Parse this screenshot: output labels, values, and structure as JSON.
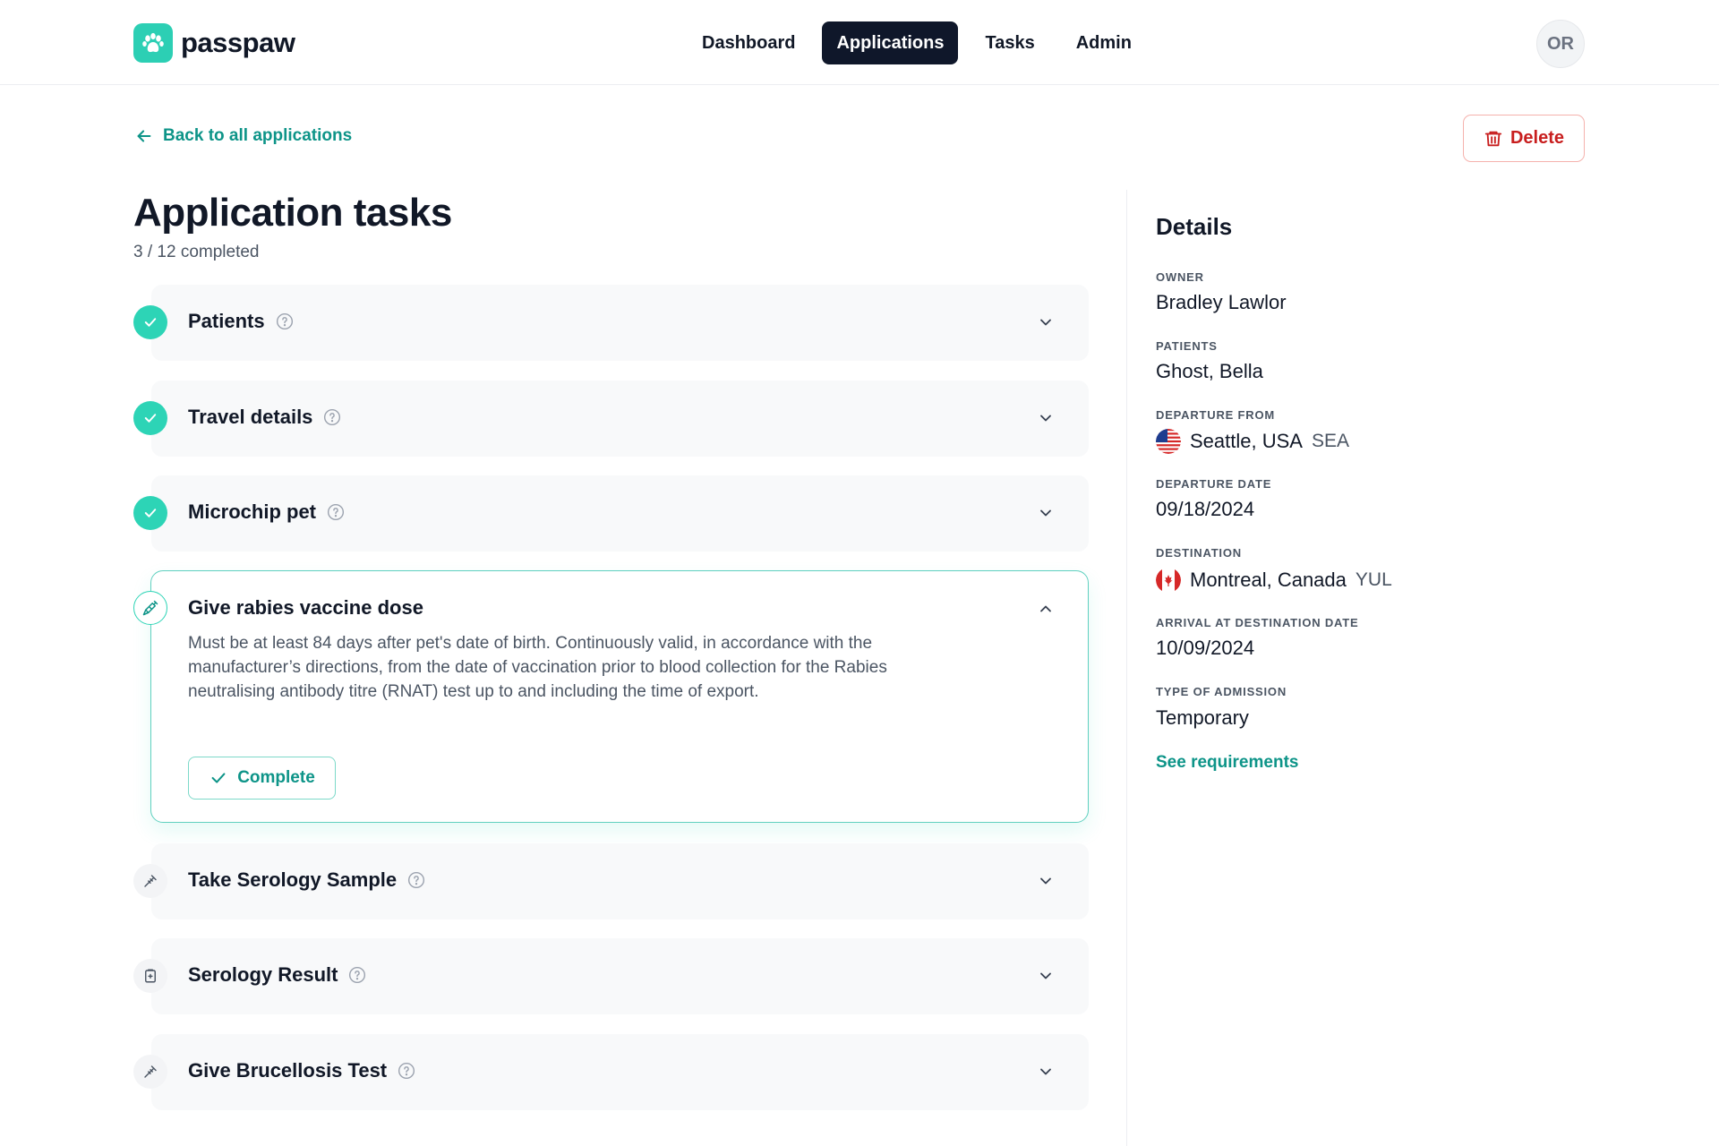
{
  "brand": {
    "name": "passpaw",
    "accent": "#2dd4b6",
    "link_color": "#0d9488",
    "danger": "#c81e1e",
    "nav_active_bg": "#0f172a"
  },
  "nav": {
    "items": [
      {
        "label": "Dashboard",
        "active": false
      },
      {
        "label": "Applications",
        "active": true
      },
      {
        "label": "Tasks",
        "active": false
      },
      {
        "label": "Admin",
        "active": false
      }
    ]
  },
  "user": {
    "initials": "OR"
  },
  "back_link": {
    "label": "Back to all applications",
    "icon": "arrow-left-icon"
  },
  "delete_button": {
    "label": "Delete",
    "icon": "trash-icon"
  },
  "page": {
    "title": "Application tasks",
    "progress": "3 / 12 completed"
  },
  "tasks": [
    {
      "title": "Patients",
      "status": "completed",
      "icon": "check-icon"
    },
    {
      "title": "Travel details",
      "status": "completed",
      "icon": "check-icon"
    },
    {
      "title": "Microchip pet",
      "status": "completed",
      "icon": "check-icon"
    },
    {
      "title": "Give rabies vaccine dose",
      "status": "in-progress",
      "expanded": true,
      "icon": "syringe-icon",
      "description": "Must be at least 84 days after pet's date of birth. Continuously valid, in accordance with the manufacturer’s directions, from the date of vaccination prior to blood collection for the Rabies neutralising antibody titre (RNAT) test up to and including the time of export.",
      "complete_label": "Complete"
    },
    {
      "title": "Take Serology Sample",
      "status": "pending",
      "icon": "pipette-icon"
    },
    {
      "title": "Serology Result",
      "status": "pending",
      "icon": "clipboard-icon"
    },
    {
      "title": "Give Brucellosis Test",
      "status": "pending",
      "icon": "pipette-icon"
    }
  ],
  "details": {
    "title": "Details",
    "owner": {
      "label": "Owner",
      "value": "Bradley Lawlor"
    },
    "patients": {
      "label": "Patients",
      "value": "Ghost, Bella"
    },
    "departure_from": {
      "label": "Departure from",
      "value": "Seattle, USA",
      "code": "SEA",
      "flag": "us-flag-icon"
    },
    "departure_date": {
      "label": "Departure date",
      "value": "09/18/2024"
    },
    "destination": {
      "label": "Destination",
      "value": "Montreal, Canada",
      "code": "YUL",
      "flag": "ca-flag-icon"
    },
    "arrival_date": {
      "label": "Arrival at destination date",
      "value": "10/09/2024"
    },
    "admission_type": {
      "label": "Type of admission",
      "value": "Temporary"
    },
    "see_requirements": "See requirements"
  }
}
